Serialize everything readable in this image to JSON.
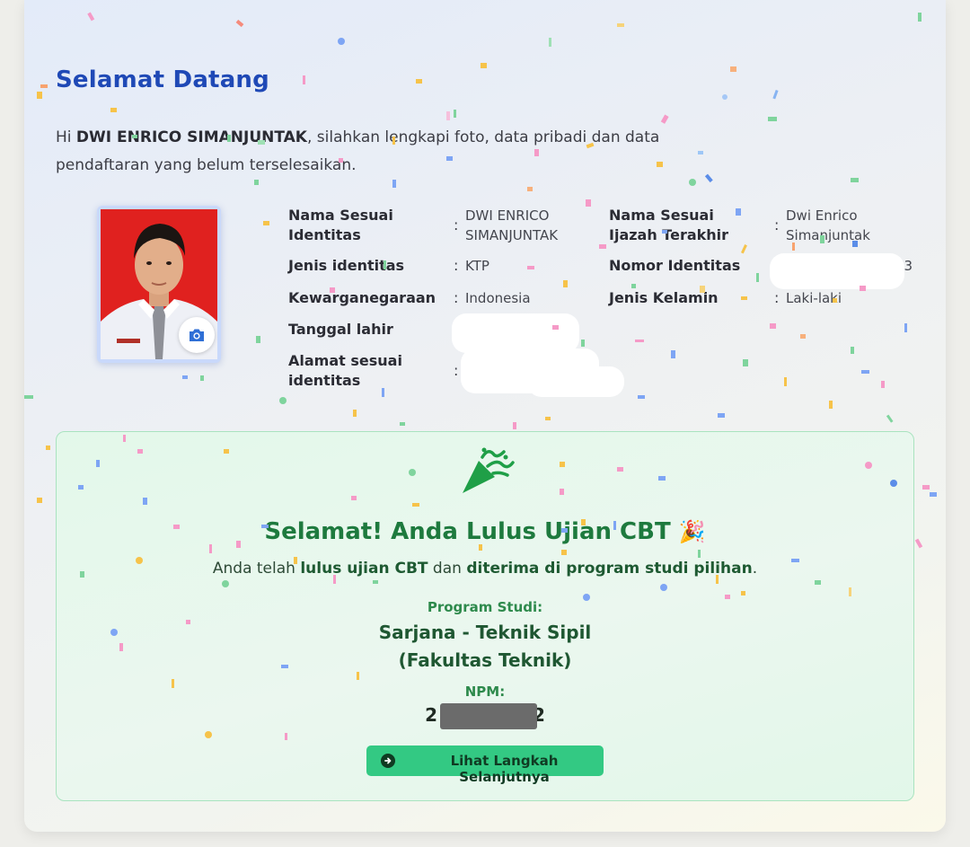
{
  "welcome": {
    "title": "Selamat Datang",
    "greeting_prefix": "Hi ",
    "user_name": "DWI ENRICO SIMANJUNTAK",
    "greeting_suffix": ", silahkan lengkapi foto, data pribadi dan data pendaftaran yang belum terselesaikan."
  },
  "profile": {
    "photo_icon": "camera-icon",
    "fields": {
      "nama_identitas": {
        "label": "Nama Sesuai Identitas",
        "value": "DWI ENRICO SIMANJUNTAK"
      },
      "nama_ijazah": {
        "label": "Nama Sesuai Ijazah Terakhir",
        "value": "Dwi Enrico Simanjuntak"
      },
      "jenis_identitas": {
        "label": "Jenis identitas",
        "value": "KTP"
      },
      "nomor_identitas": {
        "label": "Nomor Identitas",
        "value": "03"
      },
      "kewarganegaraan": {
        "label": "Kewarganegaraan",
        "value": "Indonesia"
      },
      "jenis_kelamin": {
        "label": "Jenis Kelamin",
        "value": "Laki-laki"
      },
      "tanggal_lahir": {
        "label": "Tanggal lahir",
        "value": ""
      },
      "alamat": {
        "label": "Alamat sesuai identitas",
        "value": ""
      }
    },
    "separator": ":"
  },
  "result": {
    "icon": "party-popper-icon",
    "title": "Selamat! Anda Lulus Ujian CBT",
    "title_emoji": "🎉",
    "desc_1": "Anda telah ",
    "desc_bold_1": "lulus ujian CBT",
    "desc_2": " dan ",
    "desc_bold_2": "diterima di program studi pilihan",
    "desc_3": ".",
    "program_label": "Program Studi:",
    "program_name": "Sarjana - Teknik Sipil",
    "faculty": "(Fakultas Teknik)",
    "npm_label": "NPM:",
    "npm_value_start": "2",
    "npm_value_end": "2",
    "next_button": "Lihat Langkah Selanjutnya",
    "next_icon": "arrow-circle-right-icon"
  },
  "colors": {
    "title_blue": "#1f49b6",
    "success_green": "#1e7a3e",
    "button_green": "#33c983",
    "success_bg": "#e3f8ea"
  }
}
